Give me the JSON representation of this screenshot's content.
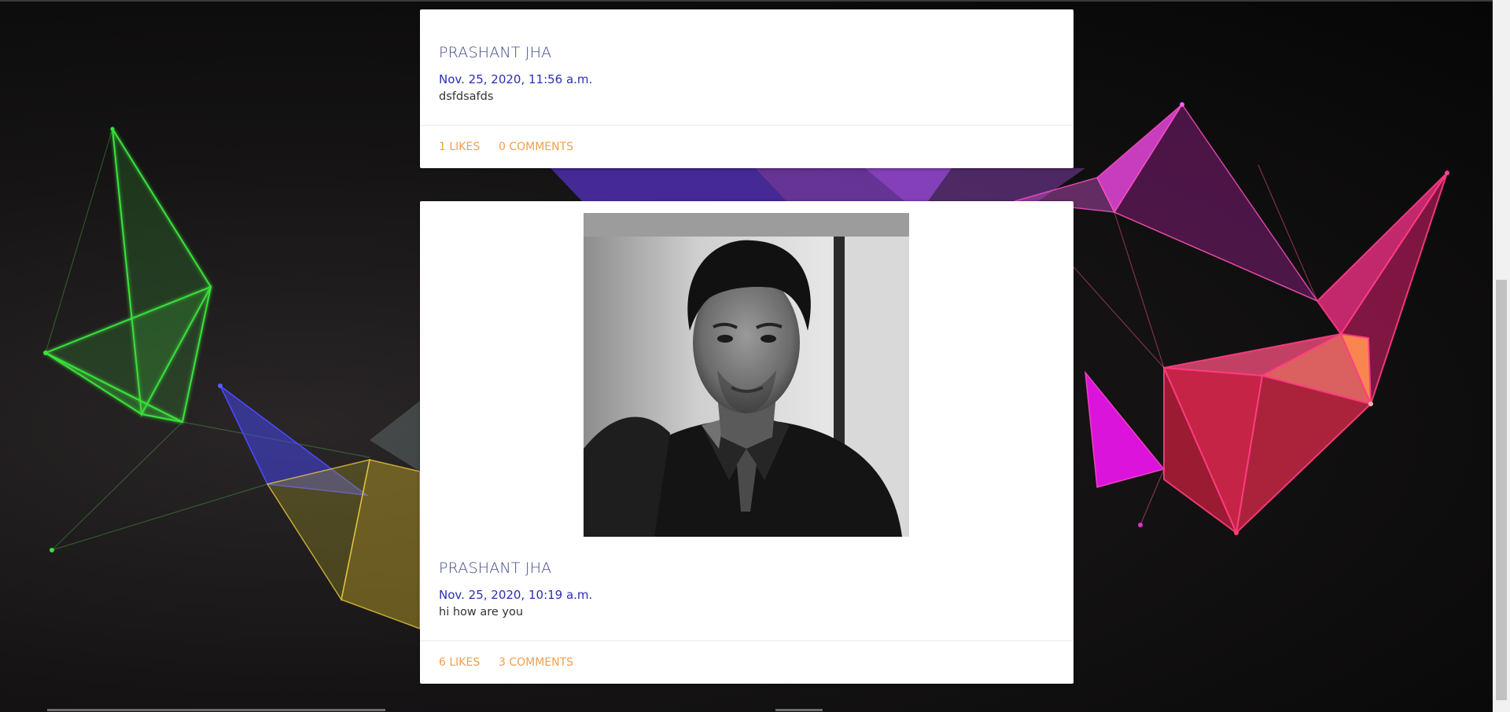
{
  "posts": [
    {
      "author": "PRASHANT JHA",
      "date": "Nov. 25, 2020, 11:56 a.m.",
      "text": "dsfdsafds",
      "likes_label": "1 LIKES",
      "comments_label": "0 COMMENTS",
      "has_photo": false
    },
    {
      "author": "PRASHANT JHA",
      "date": "Nov. 25, 2020, 10:19 a.m.",
      "text": "hi how are you",
      "likes_label": "6 LIKES",
      "comments_label": "3 COMMENTS",
      "has_photo": true,
      "photo_icon": "portrait-photo"
    }
  ],
  "colors": {
    "author": "#3f4a8a",
    "date": "#2a2fb2",
    "action": "#f0a04b",
    "card": "#ffffff"
  }
}
